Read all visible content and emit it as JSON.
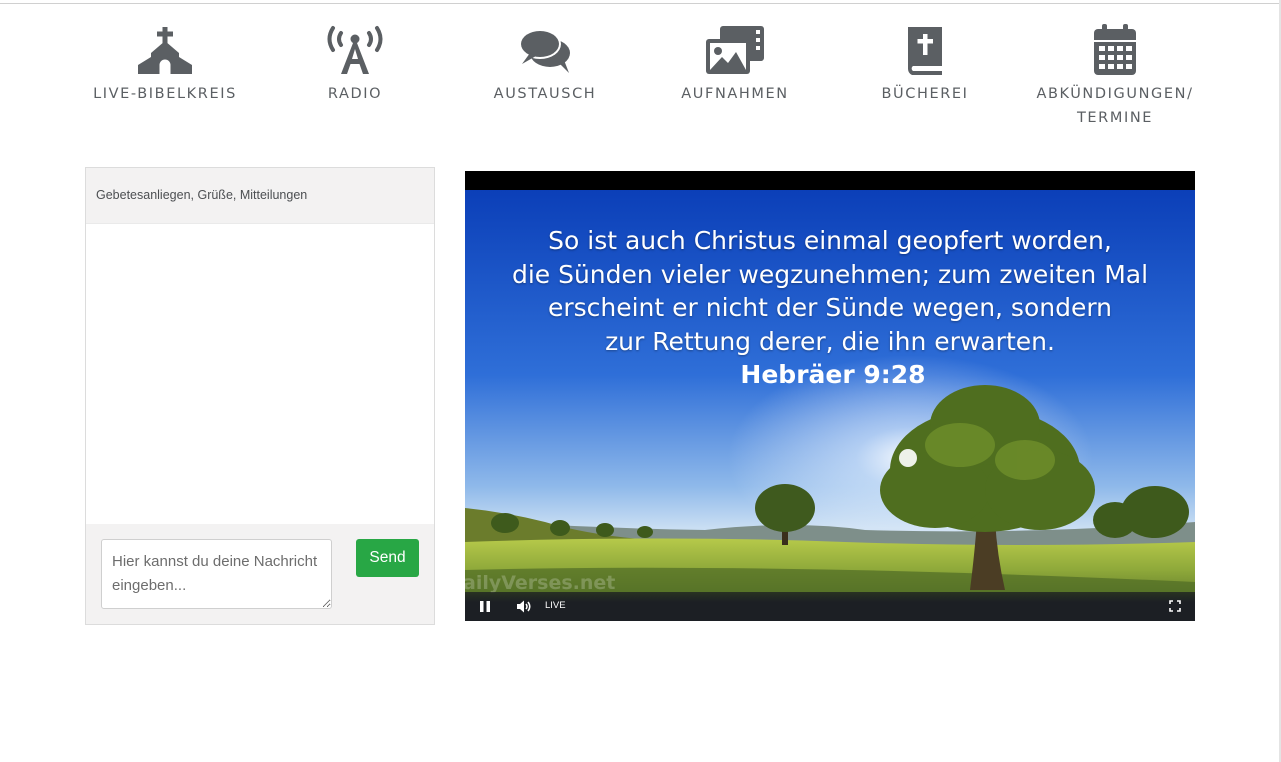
{
  "nav": {
    "items": [
      {
        "id": "live",
        "label_lines": [
          "LIVE-BIBELKREIS"
        ],
        "icon": "church-icon"
      },
      {
        "id": "radio",
        "label_lines": [
          "RADIO"
        ],
        "icon": "broadcast-tower-icon"
      },
      {
        "id": "austausch",
        "label_lines": [
          "AUSTAUSCH"
        ],
        "icon": "comments-icon"
      },
      {
        "id": "aufnahmen",
        "label_lines": [
          "AUFNAHMEN"
        ],
        "icon": "photo-video-icon"
      },
      {
        "id": "buecherei",
        "label_lines": [
          "BÜCHEREI"
        ],
        "icon": "bible-icon"
      },
      {
        "id": "termine",
        "label_lines": [
          "ABKÜNDIGUNGEN/",
          "TERMINE"
        ],
        "icon": "calendar-icon"
      }
    ]
  },
  "chat": {
    "header": "Gebetesanliegen, Grüße, Mitteilungen",
    "input_placeholder": "Hier kannst du deine Nachricht eingeben...",
    "send_label": "Send"
  },
  "video": {
    "verse_lines": [
      "So ist auch Christus einmal geopfert worden,",
      "die Sünden vieler wegzunehmen; zum zweiten Mal",
      "erscheint er nicht der Sünde wegen, sondern",
      "zur Rettung derer, die ihn erwarten."
    ],
    "reference": "Hebräer 9:28",
    "watermark": "ailyVerses.net",
    "live_label": "LIVE"
  },
  "colors": {
    "nav_icon": "#5b5f63",
    "send_button": "#28a745",
    "panel_bg": "#f3f2f2"
  }
}
